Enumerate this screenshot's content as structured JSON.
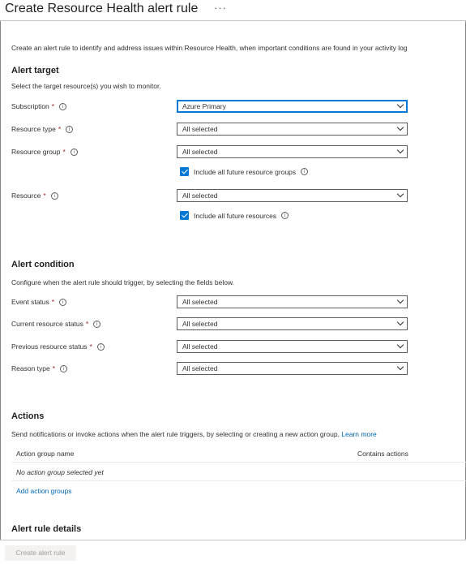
{
  "header": {
    "title": "Create Resource Health alert rule",
    "more": "···"
  },
  "intro": "Create an alert rule to identify and address issues within Resource Health, when important conditions are found in your activity log",
  "alert_target": {
    "heading": "Alert target",
    "description": "Select the target resource(s) you wish to monitor.",
    "subscription": {
      "label": "Subscription",
      "required": "*",
      "value": "Azure Primary"
    },
    "resource_type": {
      "label": "Resource type",
      "required": "*",
      "value": "All selected"
    },
    "resource_group": {
      "label": "Resource group",
      "required": "*",
      "value": "All selected"
    },
    "include_future_groups": {
      "label": "Include all future resource groups",
      "checked": true
    },
    "resource": {
      "label": "Resource",
      "required": "*",
      "value": "All selected"
    },
    "include_future_resources": {
      "label": "Include all future resources",
      "checked": true
    }
  },
  "alert_condition": {
    "heading": "Alert condition",
    "description": "Configure when the alert rule should trigger, by selecting the fields below.",
    "event_status": {
      "label": "Event status",
      "required": "*",
      "value": "All selected"
    },
    "current_status": {
      "label": "Current resource status",
      "required": "*",
      "value": "All selected"
    },
    "previous_status": {
      "label": "Previous resource status",
      "required": "*",
      "value": "All selected"
    },
    "reason_type": {
      "label": "Reason type",
      "required": "*",
      "value": "All selected"
    }
  },
  "actions": {
    "heading": "Actions",
    "description": "Send notifications or invoke actions when the alert rule triggers, by selecting or creating a new action group.",
    "learn_more": "Learn more",
    "columns": [
      "Action group name",
      "Contains actions"
    ],
    "empty_row": "No action group selected yet",
    "add_link": "Add action groups"
  },
  "details": {
    "heading": "Alert rule details"
  },
  "footer": {
    "create_label": "Create alert rule"
  },
  "colors": {
    "accent": "#0078d4",
    "link": "#0067b8",
    "required": "#a4262c",
    "disabled_text": "#a19f9d"
  },
  "icons": {
    "info": "info-icon",
    "dropdown": "chevron-down-icon",
    "checkbox": "checkmark-icon"
  }
}
